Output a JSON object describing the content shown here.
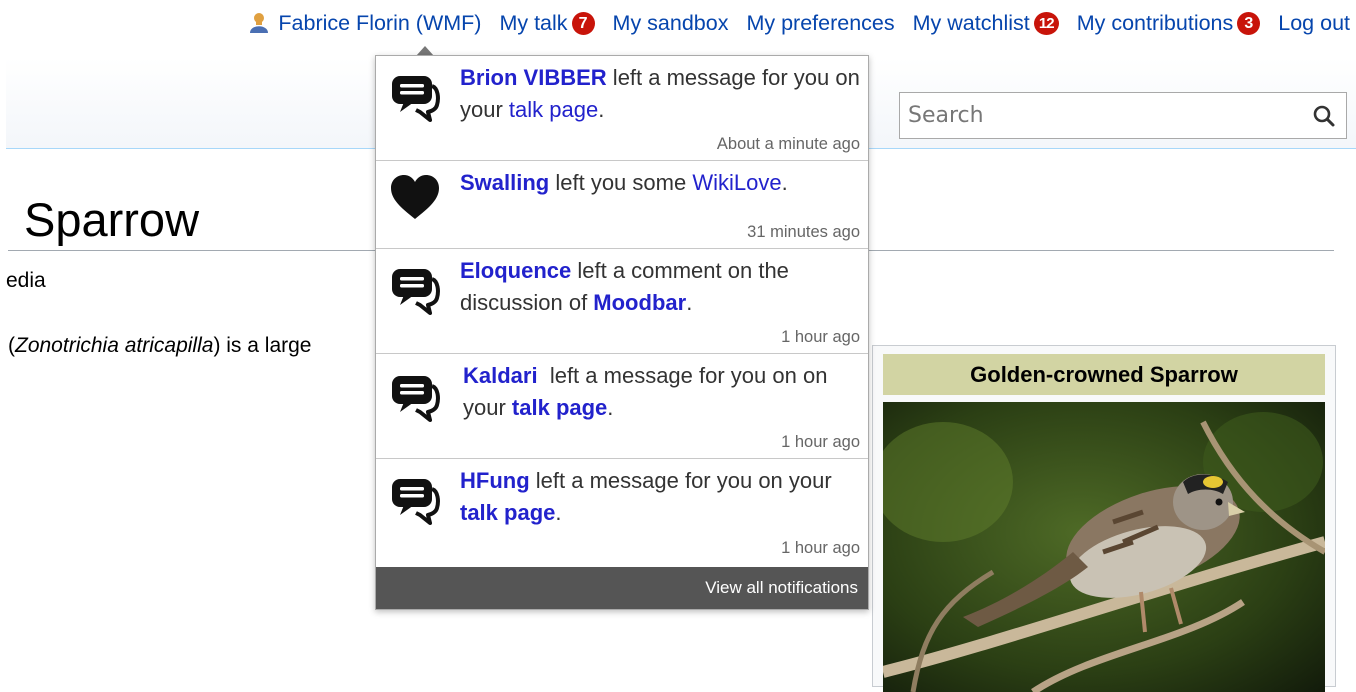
{
  "personal_tools": {
    "username": "Fabrice Florin (WMF)",
    "talk": {
      "label": "My talk",
      "count": "7"
    },
    "sandbox": "My sandbox",
    "preferences": "My preferences",
    "watchlist": {
      "label": "My watchlist",
      "count": "12"
    },
    "contributions": {
      "label": "My contributions",
      "count": "3"
    },
    "logout": "Log out"
  },
  "search": {
    "placeholder": "Search",
    "icon": "magnifier-icon"
  },
  "article": {
    "title": "Sparrow",
    "tagline": "edia",
    "lead": {
      "open": "(",
      "species": "Zonotrichia atricapilla",
      "rest": ") is a large"
    }
  },
  "infobox": {
    "title": "Golden-crowned Sparrow"
  },
  "notifications": {
    "items": [
      {
        "icon": "speech-bubbles-icon",
        "user": "Brion VIBBER",
        "pre": " left a message for you on your ",
        "link": "talk page",
        "post": ".",
        "time": "About a minute ago"
      },
      {
        "icon": "heart-icon",
        "user": "Swalling",
        "pre": " left you some ",
        "link": "WikiLove",
        "post": ".",
        "time": "31 minutes ago"
      },
      {
        "icon": "speech-bubbles-icon",
        "user": "Eloquence",
        "pre": " left a comment on the discussion of ",
        "link": "Moodbar",
        "post": ".",
        "time": "1 hour ago"
      },
      {
        "icon": "speech-bubbles-icon",
        "user": "Kaldari",
        "pre": "  left a message for you on on  your ",
        "link": "talk page",
        "post": ".",
        "time": "1 hour ago"
      },
      {
        "icon": "speech-bubbles-icon",
        "user": "HFung",
        "pre": " left a message for you on your ",
        "link": "talk page",
        "post": ".",
        "time": "1 hour ago"
      }
    ],
    "view_all": "View all notifications"
  }
}
